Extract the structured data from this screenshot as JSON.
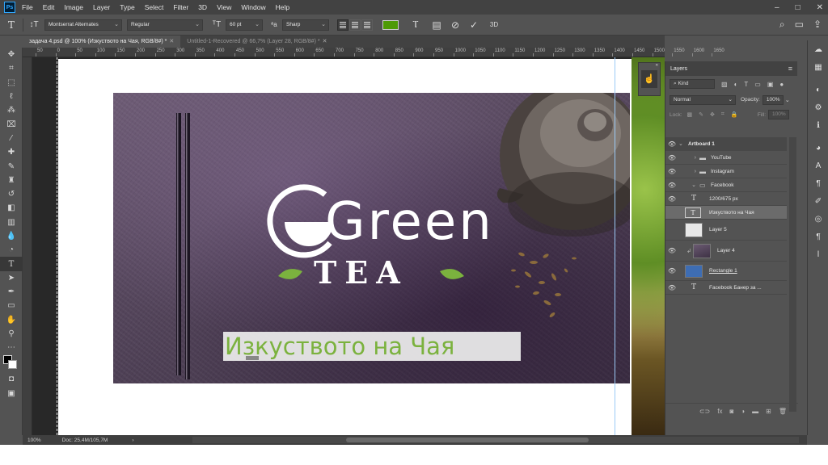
{
  "app": {
    "logo": "Ps",
    "menu": [
      "File",
      "Edit",
      "Image",
      "Layer",
      "Type",
      "Select",
      "Filter",
      "3D",
      "View",
      "Window",
      "Help"
    ],
    "window_controls": [
      "–",
      "□",
      "✕"
    ]
  },
  "options_bar": {
    "tool_icon": "type-tool-icon",
    "font_family": "Montserrat Alternates",
    "font_style": "Regular",
    "font_size": "60 pt",
    "aa_label": "ªa",
    "antialias": "Sharp",
    "text_color": "#4e9a06",
    "three_d": "3D"
  },
  "tabs": [
    {
      "label": "задача 4.psd @ 100% (Изкуството на Чая, RGB/8#) *",
      "close": "✕",
      "active": true
    },
    {
      "label": "Untitled-1-Recovered @ 66,7% (Layer 28, RGB/8#) *",
      "close": "✕",
      "active": false
    }
  ],
  "ruler": {
    "labels": [
      "50",
      "0",
      "50",
      "100",
      "150",
      "200",
      "250",
      "300",
      "350",
      "400",
      "450",
      "500",
      "550",
      "600",
      "650",
      "700",
      "750",
      "800",
      "850",
      "900",
      "950",
      "1000",
      "1050",
      "1100",
      "1150",
      "1200",
      "1250",
      "1300",
      "1350",
      "1400",
      "1450",
      "1500",
      "1550",
      "1600",
      "1650"
    ]
  },
  "canvas": {
    "brand_word": "Green",
    "brand_tea": "TEA",
    "subtitle": "Изкуството на Чая",
    "leaf_color": "#7bb23e"
  },
  "layers": {
    "title": "Layers",
    "menu_icon": "≡",
    "kind_label": "Kind",
    "blend_mode": "Normal",
    "opacity_label": "Opacity:",
    "opacity_value": "100%",
    "lock_label": "Lock:",
    "fill_label": "Fill:",
    "fill_value": "100%",
    "items": [
      {
        "name": "Artboard 1",
        "type": "artboard"
      },
      {
        "name": "YouTube",
        "type": "group"
      },
      {
        "name": "Instagram",
        "type": "group"
      },
      {
        "name": "Facebook",
        "type": "group"
      },
      {
        "name": "1200/675 px",
        "type": "text"
      },
      {
        "name": "Изкуството на Чая",
        "type": "text",
        "selected": true
      },
      {
        "name": "Layer 5",
        "type": "image"
      },
      {
        "name": "Layer 4",
        "type": "image"
      },
      {
        "name": "Rectangle 1",
        "type": "shape"
      },
      {
        "name": "Facebook Банер за ...",
        "type": "text"
      }
    ]
  },
  "status": {
    "zoom": "100%",
    "doc": "Doc: 25,4M/105,7M",
    "arrow": "›"
  }
}
